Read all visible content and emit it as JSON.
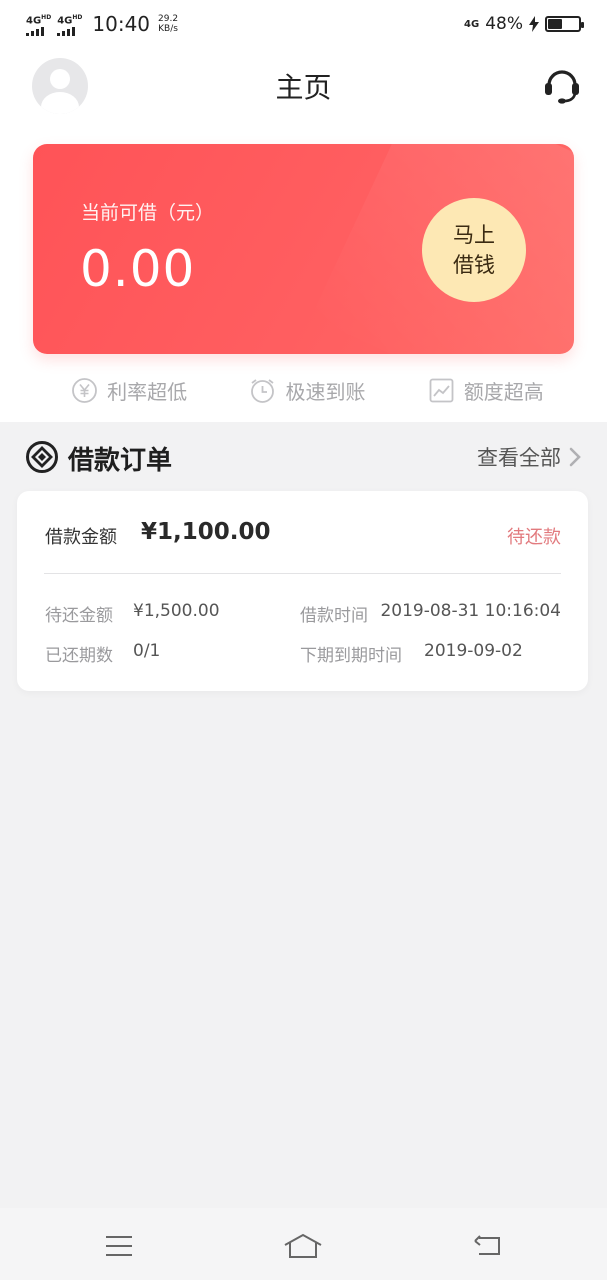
{
  "status_bar": {
    "sim1_label": "4G",
    "sim1_hd": "HD",
    "sim2_label": "4G",
    "sim2_hd": "HD",
    "time": "10:40",
    "speed_value": "29.2",
    "speed_unit": "KB/s",
    "net_label": "4G",
    "battery_pct": "48%",
    "battery_level": 0.48,
    "charging": true
  },
  "header": {
    "title": "主页"
  },
  "loan_card": {
    "available_label": "当前可借（元）",
    "available_amount": "0.00",
    "borrow_line1": "马上",
    "borrow_line2": "借钱",
    "gradient_start": "#ff5357",
    "button_color": "#fde8b4"
  },
  "features": [
    {
      "icon": "yen-circle-icon",
      "label": "利率超低"
    },
    {
      "icon": "clock-icon",
      "label": "极速到账"
    },
    {
      "icon": "chart-up-icon",
      "label": "额度超高"
    }
  ],
  "orders_section": {
    "title": "借款订单",
    "view_all": "查看全部"
  },
  "order": {
    "amount_label": "借款金额",
    "amount": "¥1,100.00",
    "status": "待还款",
    "status_color": "#e27a7e",
    "due_label": "待还金额",
    "due_amount": "¥1,500.00",
    "time_label": "借款时间",
    "time_value": "2019-08-31 10:16:04",
    "periods_label": "已还期数",
    "periods_value": "0/1",
    "next_due_label": "下期到期时间",
    "next_due_value": "2019-09-02"
  },
  "bottom_nav": {
    "icons": [
      "menu-icon",
      "home-icon",
      "back-icon"
    ]
  }
}
